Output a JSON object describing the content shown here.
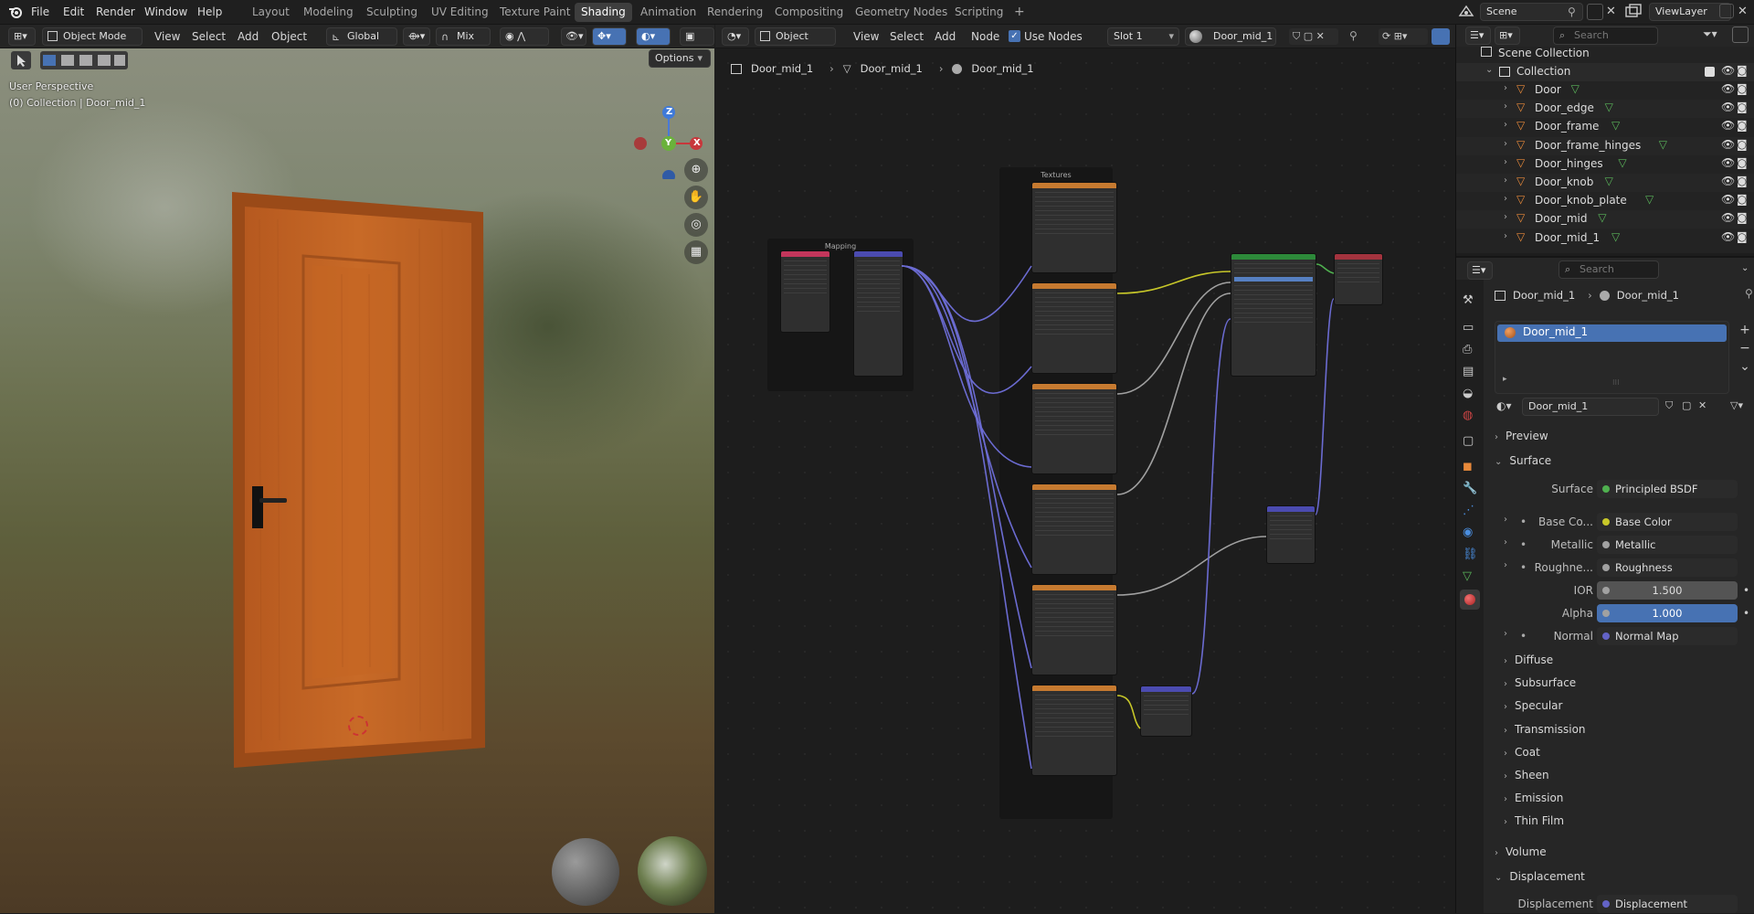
{
  "top_menu": {
    "items": [
      "File",
      "Edit",
      "Render",
      "Window",
      "Help"
    ]
  },
  "workspace_tabs": [
    "Layout",
    "Modeling",
    "Sculpting",
    "UV Editing",
    "Texture Paint",
    "Shading",
    "Animation",
    "Rendering",
    "Compositing",
    "Geometry Nodes",
    "Scripting"
  ],
  "active_tab": "Shading",
  "scene": {
    "label": "Scene",
    "view_layer": "ViewLayer"
  },
  "viewport": {
    "mode": "Object Mode",
    "menus": [
      "View",
      "Select",
      "Add",
      "Object"
    ],
    "transform": "Global",
    "pivot": "Mix",
    "options": "Options",
    "perspective": "User Perspective",
    "collection_info": "(0) Collection | Door_mid_1",
    "axes": {
      "z": "Z",
      "y": "Y",
      "x": "X"
    }
  },
  "node_editor": {
    "object_type": "Object",
    "menus": [
      "View",
      "Select",
      "Add",
      "Node"
    ],
    "use_nodes": "Use Nodes",
    "slot": "Slot 1",
    "material": "Door_mid_1",
    "breadcrumb": [
      "Door_mid_1",
      "Door_mid_1",
      "Door_mid_1"
    ],
    "frames": {
      "textures": "Textures",
      "mapping": "Mapping"
    }
  },
  "outliner": {
    "search_placeholder": "Search",
    "scene_collection": "Scene Collection",
    "collection": "Collection",
    "objects": [
      "Door",
      "Door_edge",
      "Door_frame",
      "Door_frame_hinges",
      "Door_hinges",
      "Door_knob",
      "Door_knob_plate",
      "Door_mid",
      "Door_mid_1"
    ]
  },
  "properties": {
    "search_placeholder": "Search",
    "breadcrumb": [
      "Door_mid_1",
      "Door_mid_1"
    ],
    "material_slot": "Door_mid_1",
    "material_name": "Door_mid_1",
    "sections": {
      "preview": "Preview",
      "surface": "Surface",
      "volume": "Volume",
      "displacement": "Displacement"
    },
    "surface_rows": [
      {
        "label": "Surface",
        "value": "Principled BSDF",
        "color": "#4fb04f"
      },
      {
        "label": "Base Co...",
        "value": "Base Color",
        "color": "#c7c729"
      },
      {
        "label": "Metallic",
        "value": "Metallic",
        "color": "#a1a1a1"
      },
      {
        "label": "Roughne...",
        "value": "Roughness",
        "color": "#a1a1a1"
      }
    ],
    "ior": {
      "label": "IOR",
      "value": "1.500"
    },
    "alpha": {
      "label": "Alpha",
      "value": "1.000",
      "fill": 1.0
    },
    "normal": {
      "label": "Normal",
      "value": "Normal Map",
      "color": "#6363c7"
    },
    "subsections": [
      "Diffuse",
      "Subsurface",
      "Specular",
      "Transmission",
      "Coat",
      "Sheen",
      "Emission",
      "Thin Film"
    ],
    "displacement_row": {
      "label": "Displacement",
      "value": "Displacement",
      "color": "#6363c7"
    }
  }
}
